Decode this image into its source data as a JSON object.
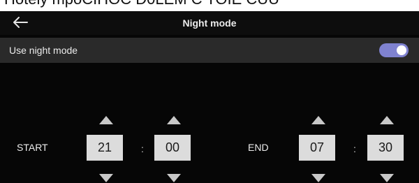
{
  "caption": {
    "text": "Hotely mpoCIHOC D0LEM C TOIE CUU"
  },
  "header": {
    "back_icon": "arrow-left-icon",
    "title": "Night mode"
  },
  "setting": {
    "label": "Use night mode",
    "enabled": true,
    "toggle_color": "#7f82d0"
  },
  "schedule": {
    "start": {
      "label": "START",
      "hour": "21",
      "minute": "00"
    },
    "end": {
      "label": "END",
      "hour": "07",
      "minute": "30"
    },
    "separator": ":",
    "up_icon": "triangle-up-icon",
    "down_icon": "triangle-down-icon"
  }
}
